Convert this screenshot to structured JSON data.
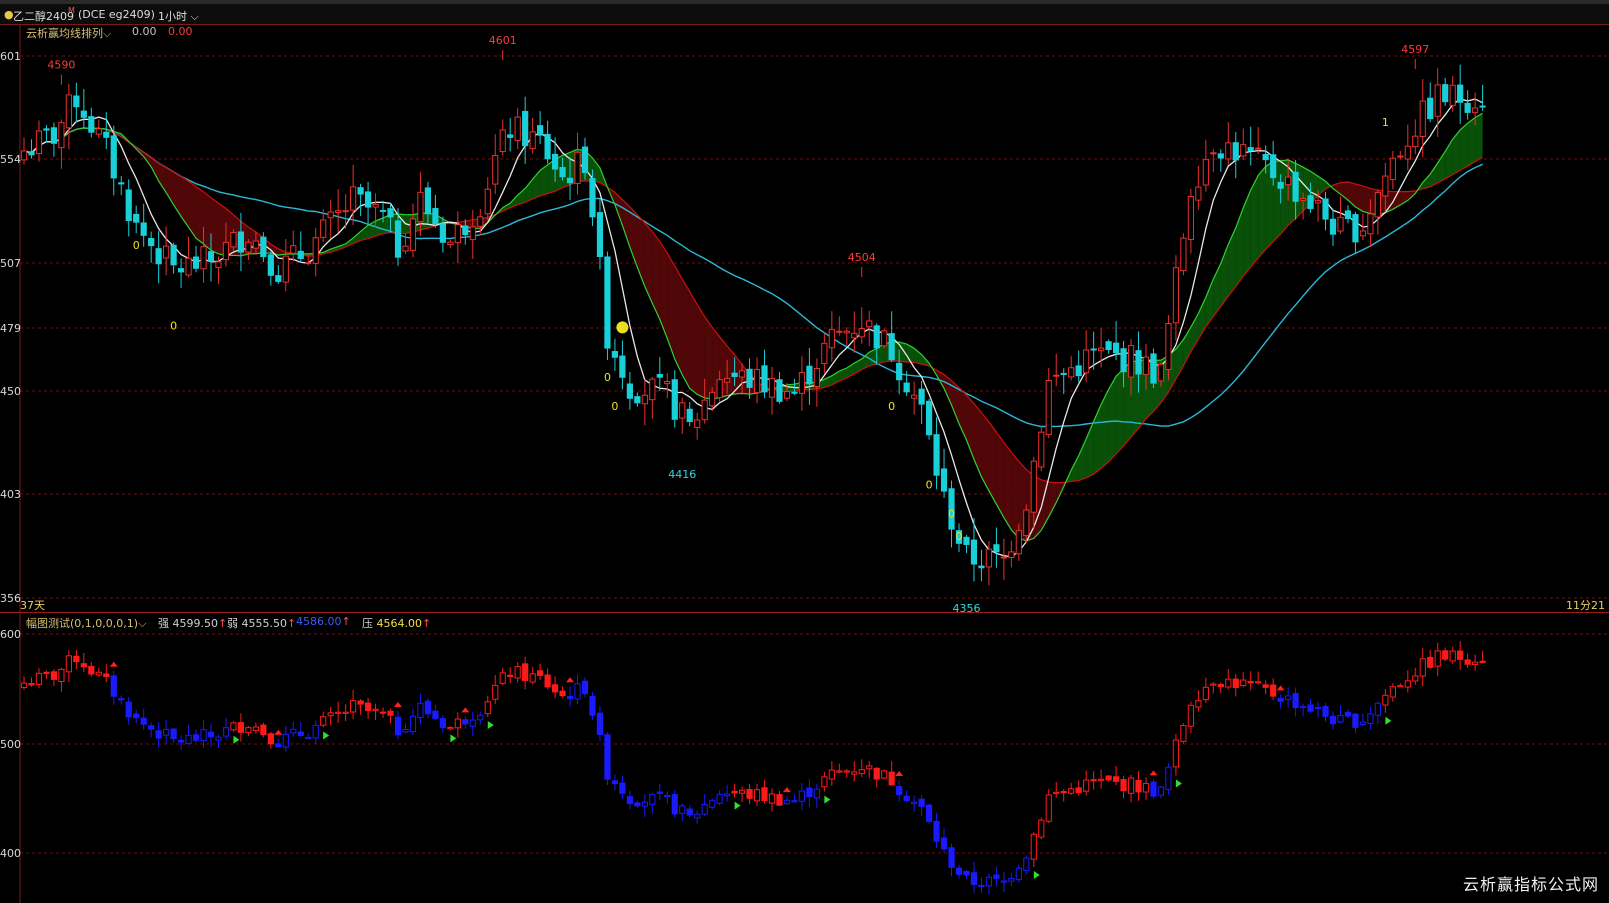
{
  "header": {
    "symbol": "乙二醇2409",
    "flag": "M",
    "contract": "(DCE eg2409)",
    "period": "1小时"
  },
  "main_panel": {
    "indicator_name": "云析赢均线排列",
    "v1": "0.00",
    "v2": "0.00",
    "bottom_left": "37天",
    "bottom_right": "11分21"
  },
  "sub_panel": {
    "indicator_name": "幅图测试(0,1,0,0,0,1)",
    "items": [
      {
        "label": "强",
        "value": "4599.50",
        "arrow": "↑"
      },
      {
        "label": "弱",
        "value": "4555.50",
        "arrow": "↑"
      },
      {
        "label": "",
        "value": "4586.00",
        "arrow": "↑"
      },
      {
        "label": "压",
        "value": "4564.00",
        "arrow": "↑"
      }
    ]
  },
  "watermark": "云析赢指标公式网",
  "colors": {
    "up": "#e8302e",
    "down": "#19d0d9",
    "ma_fast": "#e8e8e8",
    "ma_green": "#2fd12f",
    "ma_cyan": "#2ab8d8",
    "ma_red": "#cc1010",
    "cloud_bull": "#0a5a0a",
    "cloud_bear": "#5a0808",
    "grid": "#6b1111",
    "sub_up": "#ff1a1a",
    "sub_down": "#1a1aff"
  },
  "chart_data": [
    {
      "type": "candlestick",
      "name": "main",
      "y_ticks": [
        601,
        554,
        507,
        479,
        450,
        403,
        356
      ],
      "ylim": [
        4356,
        4601
      ],
      "annotations": [
        {
          "text": "4590",
          "kind": "high",
          "bar": 5,
          "value": 4590
        },
        {
          "text": "4601",
          "kind": "high",
          "bar": 64,
          "value": 4601
        },
        {
          "text": "4504",
          "kind": "high",
          "bar": 112,
          "value": 4504
        },
        {
          "text": "4416",
          "kind": "low",
          "bar": 88,
          "value": 4416
        },
        {
          "text": "4356",
          "kind": "low",
          "bar": 126,
          "value": 4356
        },
        {
          "text": "4597",
          "kind": "high",
          "bar": 186,
          "value": 4597
        }
      ],
      "markers": [
        {
          "text": "0",
          "bar": 15,
          "value": 4512
        },
        {
          "text": "0",
          "bar": 20,
          "value": 4476
        },
        {
          "text": "0",
          "bar": 78,
          "value": 4453
        },
        {
          "text": "0",
          "bar": 79,
          "value": 4440
        },
        {
          "text": "0",
          "bar": 116,
          "value": 4440
        },
        {
          "text": "0",
          "bar": 121,
          "value": 4405
        },
        {
          "text": "0",
          "bar": 124,
          "value": 4392
        },
        {
          "text": "0",
          "bar": 125,
          "value": 4382
        },
        {
          "text": "1",
          "bar": 182,
          "value": 4567
        }
      ],
      "anchors": [
        [
          0,
          4556
        ],
        [
          4,
          4563
        ],
        [
          7,
          4580
        ],
        [
          11,
          4556
        ],
        [
          15,
          4522
        ],
        [
          20,
          4503
        ],
        [
          25,
          4507
        ],
        [
          30,
          4520
        ],
        [
          34,
          4503
        ],
        [
          38,
          4512
        ],
        [
          44,
          4534
        ],
        [
          48,
          4526
        ],
        [
          50,
          4513
        ],
        [
          53,
          4534
        ],
        [
          57,
          4515
        ],
        [
          61,
          4533
        ],
        [
          63,
          4552
        ],
        [
          65,
          4566
        ],
        [
          69,
          4560
        ],
        [
          72,
          4544
        ],
        [
          75,
          4552
        ],
        [
          76,
          4530
        ],
        [
          78,
          4474
        ],
        [
          81,
          4451
        ],
        [
          86,
          4447
        ],
        [
          89,
          4432
        ],
        [
          93,
          4456
        ],
        [
          98,
          4453
        ],
        [
          103,
          4448
        ],
        [
          108,
          4472
        ],
        [
          112,
          4480
        ],
        [
          116,
          4467
        ],
        [
          120,
          4440
        ],
        [
          123,
          4400
        ],
        [
          126,
          4374
        ],
        [
          131,
          4373
        ],
        [
          134,
          4400
        ],
        [
          137,
          4452
        ],
        [
          143,
          4465
        ],
        [
          148,
          4463
        ],
        [
          152,
          4456
        ],
        [
          156,
          4540
        ],
        [
          159,
          4560
        ],
        [
          163,
          4555
        ],
        [
          168,
          4544
        ],
        [
          172,
          4533
        ],
        [
          176,
          4520
        ],
        [
          179,
          4523
        ],
        [
          183,
          4552
        ],
        [
          186,
          4567
        ],
        [
          189,
          4580
        ]
      ]
    },
    {
      "type": "candlestick",
      "name": "sub",
      "y_ticks": [
        600,
        500,
        400
      ]
    }
  ]
}
